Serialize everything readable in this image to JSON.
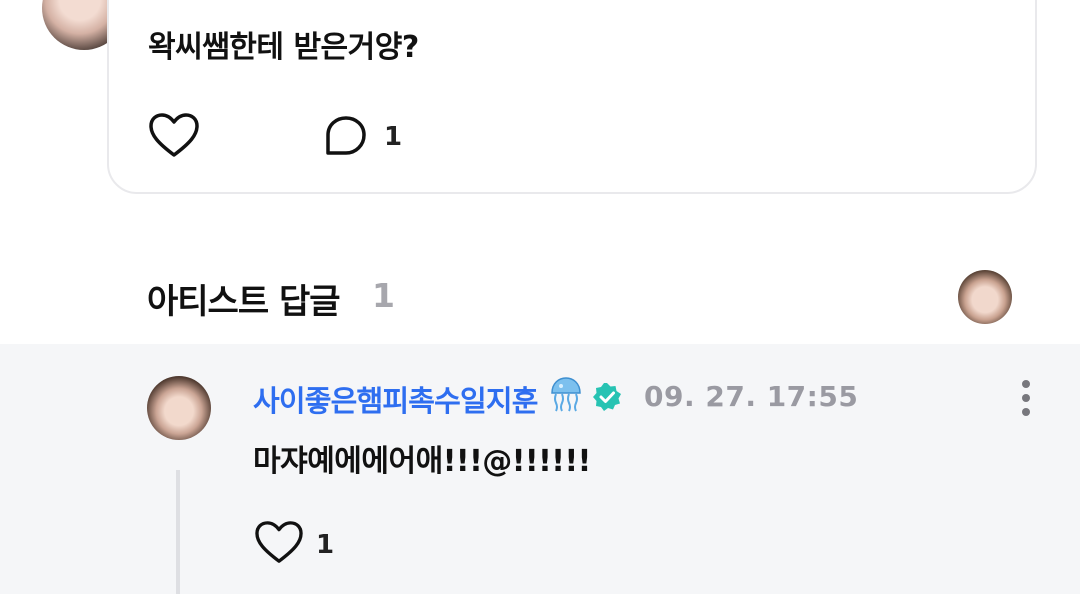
{
  "top_comment": {
    "text": "왁씨쌤한테 받은거양?",
    "reply_count": "1"
  },
  "section": {
    "title": "아티스트 답글",
    "count": "1"
  },
  "artist_reply": {
    "name": "사이좋은햄피촉수일지훈",
    "timestamp": "09. 27. 17:55",
    "text": "마쟈예에에어애!!!@!!!!!!",
    "like_count": "1"
  },
  "icons": {
    "like": "heart-outline-icon",
    "comment": "speech-bubble-icon",
    "verified": "verified-badge-icon",
    "more": "more-vertical-icon",
    "emoji": "jellyfish-emoji"
  },
  "colors": {
    "name_blue": "#2e6ef0",
    "verified_teal": "#27c3b3",
    "muted_gray": "#9a9aa2",
    "reply_bg": "#f5f6f8"
  }
}
